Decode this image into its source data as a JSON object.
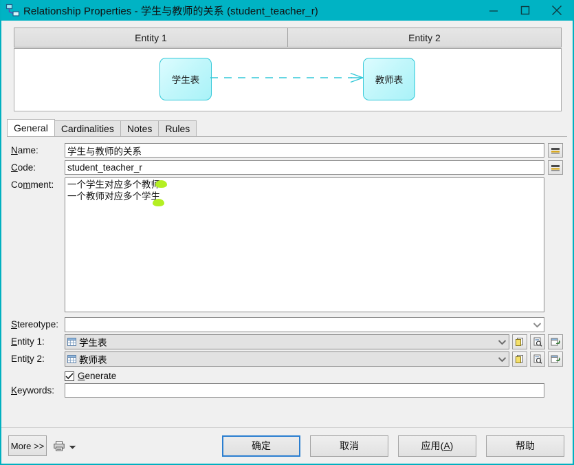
{
  "window": {
    "title": "Relationship Properties - 学生与教师的关系 (student_teacher_r)",
    "icon": "relationship-icon",
    "controls": {
      "minimize": "minimize-icon",
      "maximize": "maximize-icon",
      "close": "close-icon"
    },
    "accent_color": "#00b3c4"
  },
  "diagram": {
    "headers": [
      "Entity 1",
      "Entity 2"
    ],
    "entity1_label": "学生表",
    "entity2_label": "教师表",
    "line_style": "dashed",
    "line_color": "#32c8d8",
    "entity_fill": "#c3f7fb",
    "entity_border": "#32c8d8",
    "cardinality_marker": "crows-foot-entity2"
  },
  "tabs": [
    {
      "label": "General",
      "active": true
    },
    {
      "label": "Cardinalities",
      "active": false
    },
    {
      "label": "Notes",
      "active": false
    },
    {
      "label": "Rules",
      "active": false
    }
  ],
  "general": {
    "name": {
      "label_pre": "",
      "label_mnemonic": "N",
      "label_post": "ame:",
      "value": "学生与教师的关系",
      "button": "="
    },
    "code": {
      "label_mnemonic": "C",
      "label_post": "ode:",
      "value": "student_teacher_r",
      "button": "="
    },
    "comment": {
      "label_pre": "Co",
      "label_mnemonic": "m",
      "label_post": "ment:",
      "line1": "一个学生对应多个教师",
      "line2": "一个教师对应多个学生"
    },
    "stereotype": {
      "label_mnemonic": "S",
      "label_post": "tereotype:",
      "value": "",
      "options": []
    },
    "entity1": {
      "label_pre": "",
      "label_mnemonic": "E",
      "label_post": "ntity 1:",
      "value": "学生表",
      "icon": "table-icon",
      "buttons": [
        "create-object-icon",
        "object-properties-icon",
        "select-object-icon"
      ]
    },
    "entity2": {
      "label_pre": "Enti",
      "label_mnemonic": "t",
      "label_post": "y 2:",
      "value": "教师表",
      "icon": "table-icon",
      "buttons": [
        "create-object-icon",
        "object-properties-icon",
        "select-object-icon"
      ]
    },
    "generate": {
      "label_pre": "",
      "label_mnemonic": "G",
      "label_post": "enerate",
      "checked": true
    },
    "keywords": {
      "label_mnemonic": "K",
      "label_post": "eywords:",
      "value": ""
    }
  },
  "footer": {
    "more": "More >>",
    "print_icon": "print-icon",
    "print_dropdown": "chevron-down-icon",
    "ok": "确定",
    "cancel": "取消",
    "apply_pre": "应用(",
    "apply_mnemonic": "A",
    "apply_post": ")",
    "help": "帮助"
  }
}
